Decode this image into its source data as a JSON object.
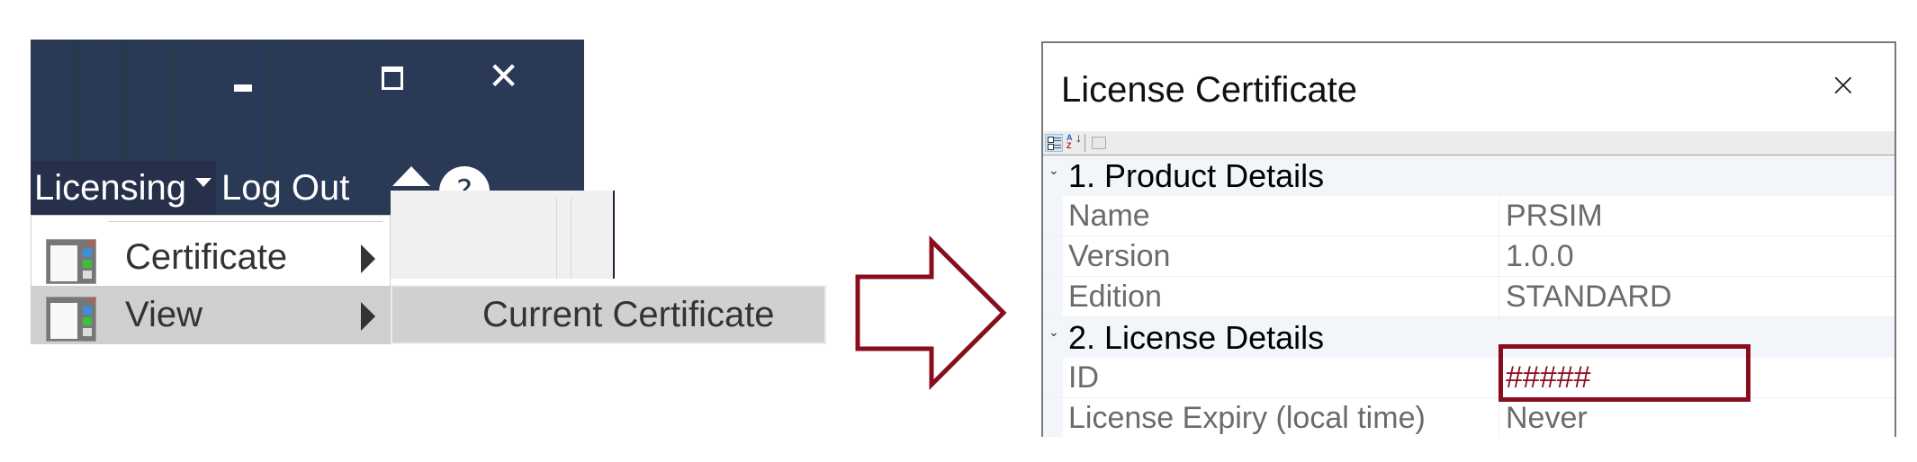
{
  "app": {
    "window_controls": {
      "minimize": "minimize",
      "maximize": "maximize",
      "close": "close"
    },
    "menubar": {
      "licensing_label": "Licensing",
      "logout_label": "Log Out",
      "help_glyph": "?"
    },
    "dropdown": {
      "items": [
        {
          "label": "Certificate",
          "icon": "certificate-icon",
          "has_submenu": true
        },
        {
          "label": "View",
          "icon": "view-icon",
          "has_submenu": true
        }
      ],
      "submenu": {
        "items": [
          {
            "label": "Current Certificate"
          }
        ]
      }
    }
  },
  "arrow": {
    "color": "#8a0d1e",
    "meaning": "leads-to"
  },
  "dialog": {
    "title": "License Certificate",
    "close_glyph": "×",
    "toolbar": {
      "categorized": "categorized-icon",
      "alphabetical": "alphabetical-sort-icon",
      "property_pages": "property-pages-icon"
    },
    "categories": [
      {
        "label": "1. Product Details",
        "properties": [
          {
            "name": "Name",
            "value": "PRSIM"
          },
          {
            "name": "Version",
            "value": "1.0.0"
          },
          {
            "name": "Edition",
            "value": "STANDARD"
          }
        ]
      },
      {
        "label": "2. License Details",
        "properties": [
          {
            "name": "ID",
            "value": "#####",
            "highlighted": true
          },
          {
            "name": "License Expiry (local time)",
            "value": "Never"
          }
        ]
      }
    ],
    "highlight_color": "#8a0d1e"
  }
}
